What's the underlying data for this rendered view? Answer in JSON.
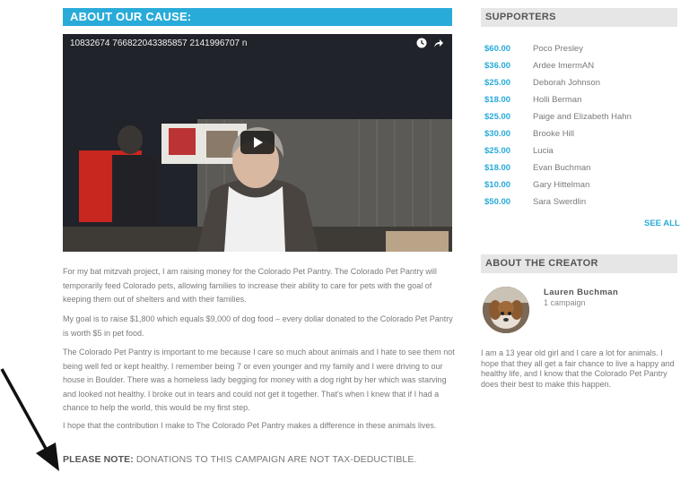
{
  "cause": {
    "header": "ABOUT OUR CAUSE:",
    "video_title": "10832674 766822043385857 2141996707 n",
    "paragraphs": [
      "For my bat mitzvah project, I am raising money for the Colorado Pet Pantry. The Colorado Pet Pantry will temporarily feed Colorado pets, allowing families to increase their ability to care for pets with the goal of keeping them out of shelters and with their families.",
      "My goal is to raise $1,800 which equals $9,000 of dog food – every dollar donated to the Colorado Pet Pantry is worth $5 in pet food.",
      "The Colorado Pet Pantry is important to me because I care so much about animals and I hate to see them not being well fed or kept healthy. I remember being 7 or even younger and my family and I were driving to our house in Boulder. There was a homeless lady begging for money with a dog right by her which was starving and looked not healthy. I broke out in tears and could not get it together. That's when I knew that if I had a chance to help the world, this would be my first step.",
      "I hope that the contribution I make to The Colorado Pet Pantry makes a difference in these animals lives."
    ],
    "note_label": "PLEASE NOTE:",
    "note_text": " DONATIONS TO THIS CAMPAIGN ARE NOT TAX-DEDUCTIBLE."
  },
  "supporters": {
    "header": "SUPPORTERS",
    "items": [
      {
        "amount": "$60.00",
        "name": "Poco Presley"
      },
      {
        "amount": "$36.00",
        "name": "Ardee ImermAN"
      },
      {
        "amount": "$25.00",
        "name": "Deborah Johnson"
      },
      {
        "amount": "$18.00",
        "name": "Holli Berman"
      },
      {
        "amount": "$25.00",
        "name": "Paige and Elizabeth Hahn"
      },
      {
        "amount": "$30.00",
        "name": "Brooke Hill"
      },
      {
        "amount": "$25.00",
        "name": "Lucia"
      },
      {
        "amount": "$18.00",
        "name": "Evan Buchman"
      },
      {
        "amount": "$10.00",
        "name": "Gary Hittelman"
      },
      {
        "amount": "$50.00",
        "name": "Sara Swerdlin"
      }
    ],
    "see_all": "SEE ALL"
  },
  "creator": {
    "header": "ABOUT THE CREATOR",
    "name": "Lauren Buchman",
    "campaigns": "1 campaign",
    "bio": "I am a 13 year old girl and I care a lot for animals. I hope that they all get a fair chance to live a happy and healthy life, and I know that the Colorado Pet Pantry does their best to make this happen."
  },
  "icons": [
    "play-icon",
    "clock-icon",
    "share-icon",
    "arrow-pointer-icon"
  ],
  "colors": {
    "accent": "#29abd9",
    "panel_header": "#e6e6e6",
    "text": "#7a7a7a"
  }
}
